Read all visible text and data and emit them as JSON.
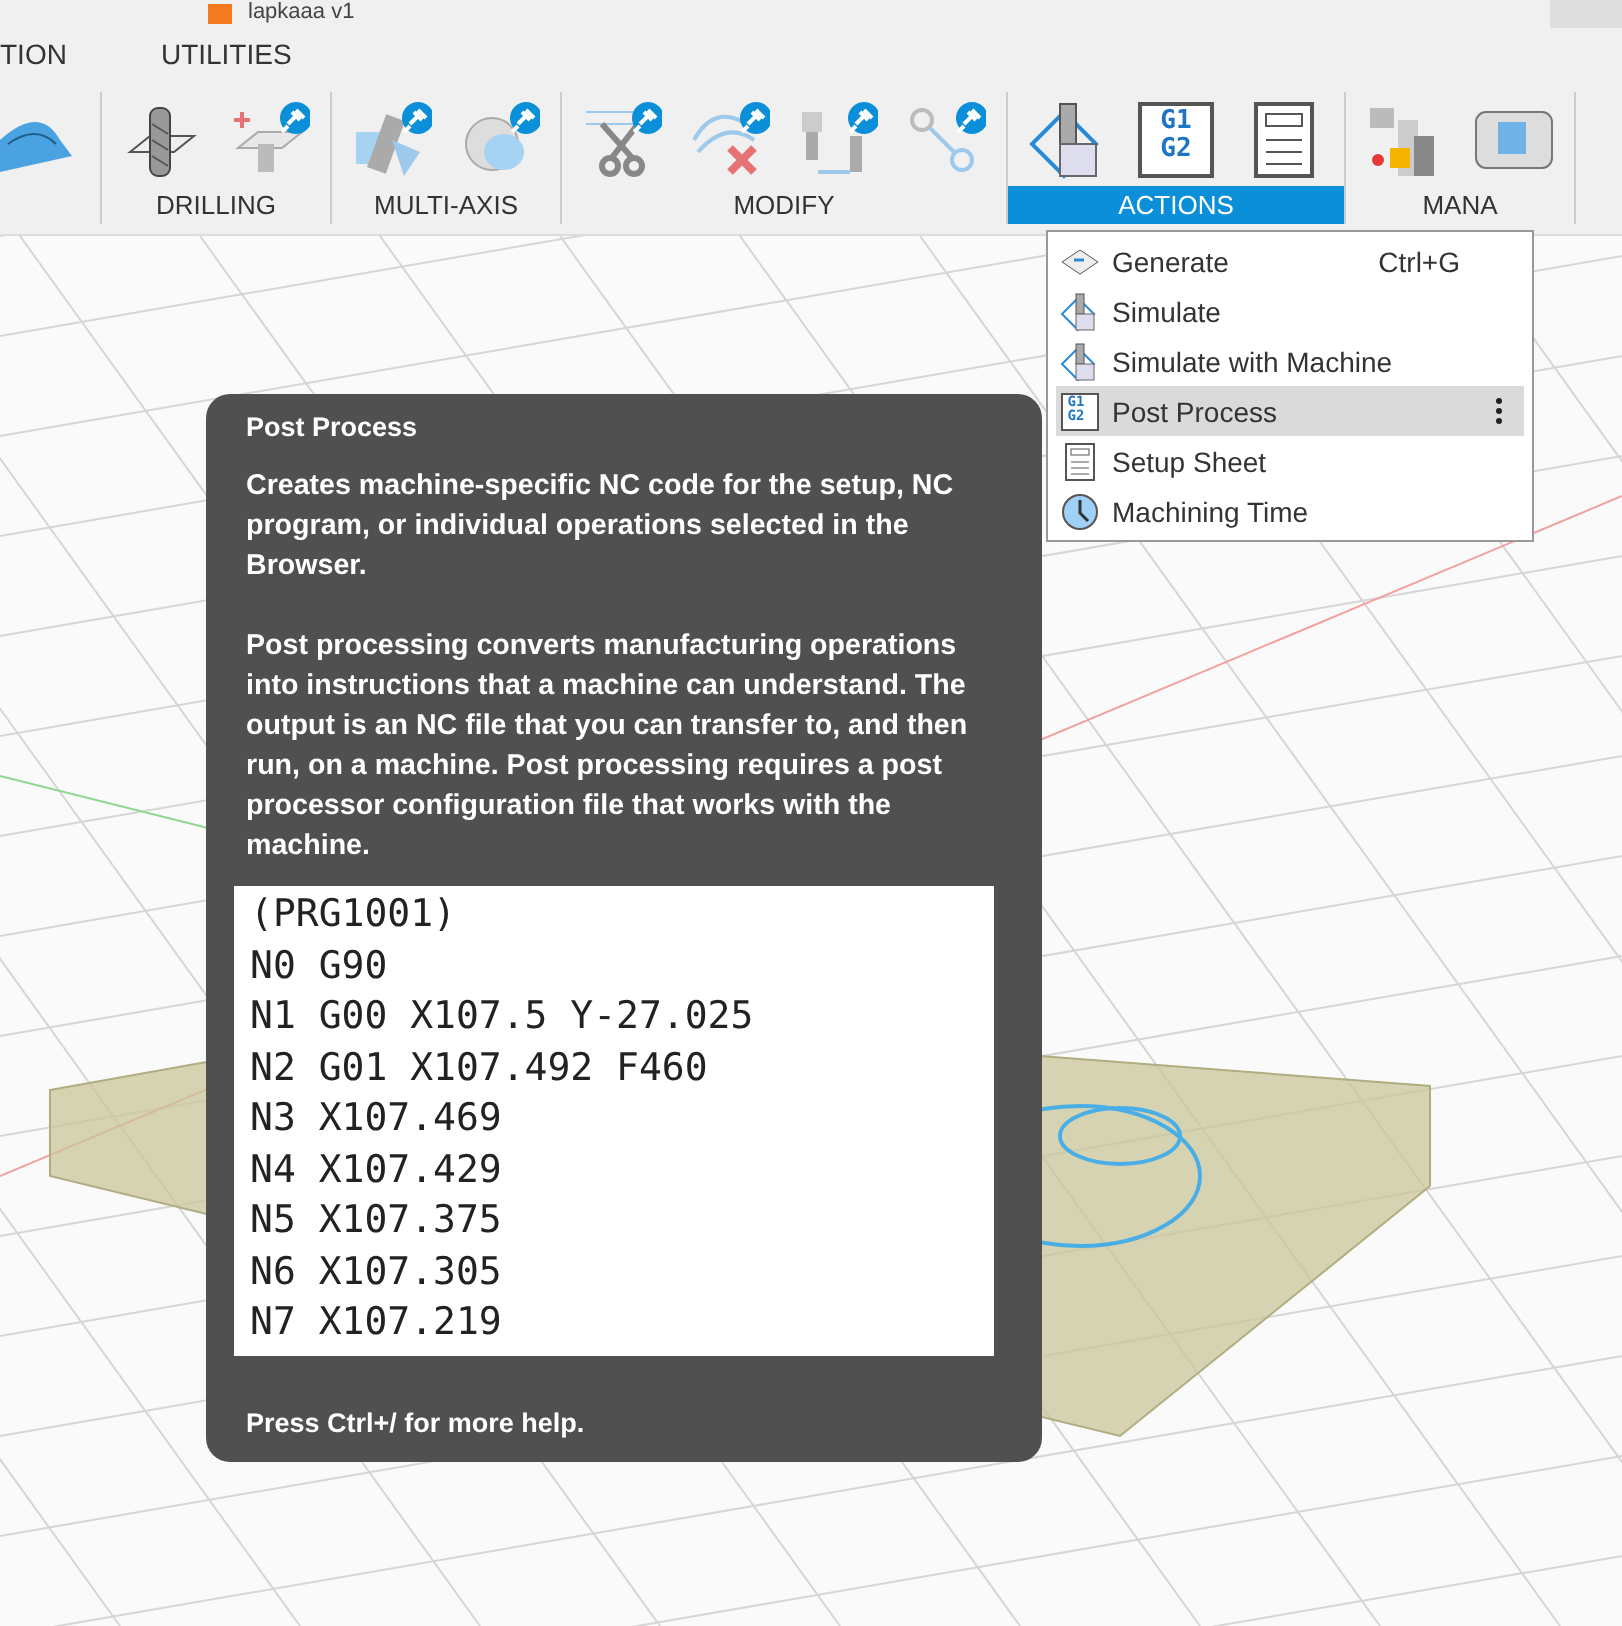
{
  "window": {
    "title": "lapkaaa v1"
  },
  "tabs": [
    {
      "label": "TION"
    },
    {
      "label": "UTILITIES"
    }
  ],
  "toolbar": [
    {
      "tools": [
        {
          "kind": "adaptive"
        }
      ]
    },
    {
      "label": "DRILLING",
      "open": false,
      "tools": [
        {
          "kind": "drill"
        },
        {
          "kind": "hole"
        }
      ]
    },
    {
      "label": "MULTI-AXIS",
      "open": false,
      "tools": [
        {
          "kind": "multiaxis"
        },
        {
          "kind": "rotary"
        }
      ]
    },
    {
      "label": "MODIFY",
      "open": false,
      "tools": [
        {
          "kind": "trim"
        },
        {
          "kind": "delete"
        },
        {
          "kind": "toolchange"
        },
        {
          "kind": "pattern"
        }
      ]
    },
    {
      "label": "ACTIONS",
      "open": true,
      "tools": [
        {
          "kind": "simulate"
        },
        {
          "kind": "post",
          "code": [
            "G1",
            "G2"
          ]
        },
        {
          "kind": "sheet"
        }
      ]
    },
    {
      "label": "MANA",
      "open": false,
      "tools": [
        {
          "kind": "library"
        },
        {
          "kind": "machine"
        }
      ]
    }
  ],
  "actions_menu": [
    {
      "kind": "generate",
      "label": "Generate",
      "shortcut": "Ctrl+G",
      "selected": false
    },
    {
      "kind": "simulate",
      "label": "Simulate",
      "selected": false
    },
    {
      "kind": "machine",
      "label": "Simulate with Machine",
      "selected": false
    },
    {
      "kind": "post",
      "label": "Post Process",
      "code": [
        "G1",
        "G2"
      ],
      "selected": true
    },
    {
      "kind": "sheet",
      "label": "Setup Sheet",
      "selected": false
    },
    {
      "kind": "time",
      "label": "Machining Time",
      "selected": false
    }
  ],
  "tooltip": {
    "title": "Post Process",
    "paragraphs": [
      "Creates machine-specific NC code for the setup, NC program, or individual operations selected in the Browser.",
      "Post processing converts manufacturing operations into instructions that a machine can understand. The output is an NC file that you can transfer to, and then run, on a machine. Post processing requires a post processor configuration file that works with the machine."
    ],
    "code_lines": [
      "(PRG1001)",
      "N0 G90",
      "N1 G00 X107.5 Y-27.025",
      "N2 G01 X107.492 F460",
      "N3 X107.469",
      "N4 X107.429",
      "N5 X107.375",
      "N6 X107.305",
      "N7 X107.219"
    ],
    "footer": "Press Ctrl+/ for more help."
  }
}
